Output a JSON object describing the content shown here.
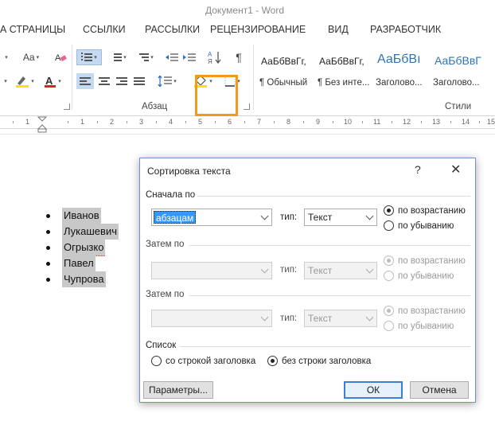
{
  "window": {
    "title": "Документ1 - Word"
  },
  "tabs": [
    "А СТРАНИЦЫ",
    "ССЫЛКИ",
    "РАССЫЛКИ",
    "РЕЦЕНЗИРОВАНИЕ",
    "ВИД",
    "РАЗРАБОТЧИК"
  ],
  "ribbon": {
    "font_size_label": "Aa",
    "paragraph_group_label": "Абзац",
    "styles_group_label": "Стили",
    "pilcrow": "¶",
    "styles": [
      {
        "sample": "АаБбВвГг,",
        "name": "¶ Обычный"
      },
      {
        "sample": "АаБбВвГг,",
        "name": "¶ Без инте..."
      },
      {
        "sample": "АаБбВı",
        "name": "Заголово..."
      },
      {
        "sample": "АаБбВвГ",
        "name": "Заголово..."
      }
    ],
    "accent_highlight_color": "#f39a1d"
  },
  "ruler": {
    "numbers": [
      "1",
      "1",
      "2",
      "3",
      "4",
      "5",
      "6",
      "7",
      "8",
      "9",
      "10",
      "11",
      "12",
      "13",
      "14",
      "15"
    ]
  },
  "document": {
    "items": [
      "Иванов",
      "Лукашевич",
      "Огрызко",
      "Павел",
      "Чупрова"
    ]
  },
  "dialog": {
    "title": "Сортировка текста",
    "help": "?",
    "close": "✕",
    "first": {
      "label": "Сначала по",
      "field_value": "абзацам",
      "type_label": "тип:",
      "type_value": "Текст",
      "asc": "по возрастанию",
      "desc": "по убыванию"
    },
    "then1": {
      "label": "Затем по",
      "field_value": "",
      "type_label": "тип:",
      "type_value": "Текст",
      "asc": "по возрастанию",
      "desc": "по убыванию"
    },
    "then2": {
      "label": "Затем по",
      "field_value": "",
      "type_label": "тип:",
      "type_value": "Текст",
      "asc": "по возрастанию",
      "desc": "по убыванию"
    },
    "list": {
      "label": "Список",
      "with_header": "со строкой заголовка",
      "without_header": "без строки заголовка"
    },
    "buttons": {
      "options": "Параметры...",
      "ok": "ОК",
      "cancel": "Отмена"
    }
  }
}
